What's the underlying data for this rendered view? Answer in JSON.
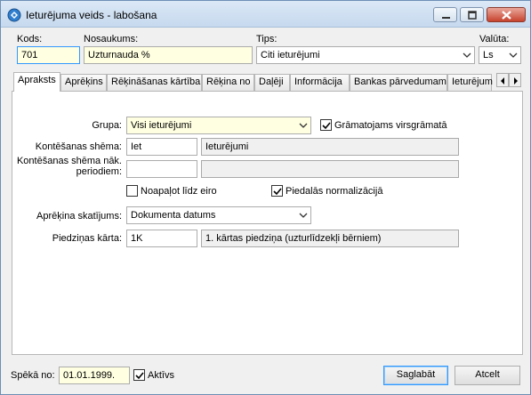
{
  "window": {
    "title": "Ieturējuma veids - labošana",
    "app_icon": "gear-globe-icon",
    "controls": [
      "minimize-icon",
      "maximize-icon",
      "close-icon"
    ]
  },
  "header": {
    "kods_label": "Kods:",
    "kods_value": "701",
    "nosaukums_label": "Nosaukums:",
    "nosaukums_value": "Uzturnauda  %",
    "tips_label": "Tips:",
    "tips_value": "Citi ieturējumi",
    "valuta_label": "Valūta:",
    "valuta_value": "Ls"
  },
  "tabs": [
    "Apraksts",
    "Aprēķins",
    "Rēķināšanas kārtība",
    "Rēķina no",
    "Daļēji",
    "Informācija",
    "Bankas pārvedumam",
    "Ieturējum"
  ],
  "active_tab": "Apraksts",
  "form": {
    "grupa_label": "Grupa:",
    "grupa_value": "Visi ieturējumi",
    "gramatojams_label": "Grāmatojams virsgrāmatā",
    "gramatojams_checked": true,
    "kontesanas_label": "Kontēšanas shēma:",
    "kontesanas_code": "Iet",
    "kontesanas_name": "Ieturējumi",
    "kontesanas_nak_label_1": "Kontēšanas shēma nāk.",
    "kontesanas_nak_label_2": "periodiem:",
    "kontesanas_nak_code": "",
    "kontesanas_nak_name": "",
    "noapalot_label": "Noapaļot līdz eiro",
    "noapalot_checked": false,
    "piedalas_label": "Piedalās normalizācijā",
    "piedalas_checked": true,
    "apreķina_label": "Aprēķina skatījums:",
    "apreķina_value": "Dokumenta datums",
    "piedzinas_label": "Piedziņas kārta:",
    "piedzinas_code": "1K",
    "piedzinas_name": "1. kārtas piedziņa (uzturlīdzekļi bērniem)"
  },
  "footer": {
    "speka_label": "Spēkā no:",
    "speka_value": "01.01.1999.",
    "aktivs_label": "Aktīvs",
    "aktivs_checked": true,
    "save_label": "Saglabāt",
    "cancel_label": "Atcelt"
  }
}
